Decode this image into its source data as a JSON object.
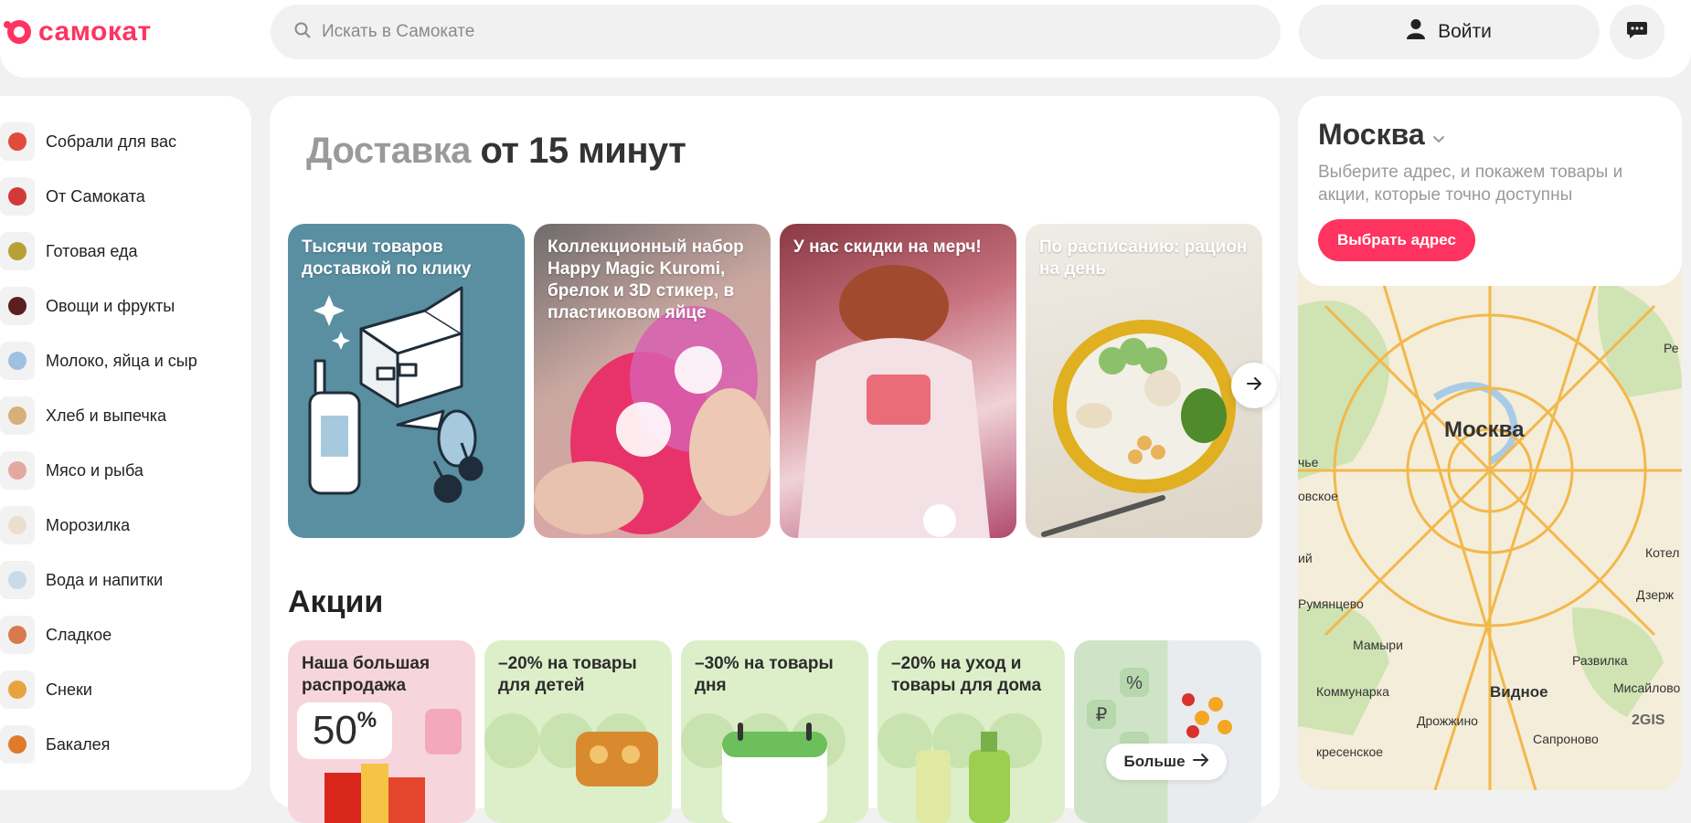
{
  "header": {
    "logo_text": "самокат",
    "search_placeholder": "Искать в Самокате",
    "login_label": "Войти"
  },
  "sidebar": {
    "items": [
      {
        "label": "Собрали для вас",
        "color": "#e04b3a"
      },
      {
        "label": "От Самоката",
        "color": "#d23a3a"
      },
      {
        "label": "Готовая еда",
        "color": "#b7a137"
      },
      {
        "label": "Овощи и фрукты",
        "color": "#5a1f1f"
      },
      {
        "label": "Молоко, яйца и сыр",
        "color": "#9fc0e0"
      },
      {
        "label": "Хлеб и выпечка",
        "color": "#d6b079"
      },
      {
        "label": "Мясо и рыба",
        "color": "#e4a8a0"
      },
      {
        "label": "Морозилка",
        "color": "#eadfcf"
      },
      {
        "label": "Вода и напитки",
        "color": "#c8dbe6"
      },
      {
        "label": "Сладкое",
        "color": "#d97a4c"
      },
      {
        "label": "Снеки",
        "color": "#e8a341"
      },
      {
        "label": "Бакалея",
        "color": "#e07a2c"
      }
    ]
  },
  "main": {
    "headline_muted": "Доставка",
    "headline_dark": "от 15 минут",
    "stories": [
      {
        "title": "Тысячи товаров доставкой по клику"
      },
      {
        "title": "Коллекционный набор Happy Magic Kuromi, брелок и 3D стикер, в пластиковом яйце"
      },
      {
        "title": "У нас скидки на мерч!"
      },
      {
        "title": "По расписанию: рацион на день"
      }
    ],
    "promos_title": "Акции",
    "promos": [
      {
        "title": "Наша большая распродажа",
        "badge": "50",
        "badge_suffix": "%"
      },
      {
        "title": "–20% на товары для детей"
      },
      {
        "title": "–30% на товары дня"
      },
      {
        "title": "–20% на уход и товары для дома"
      },
      {
        "title": "",
        "more_label": "Больше"
      }
    ]
  },
  "location": {
    "city": "Москва",
    "hint": "Выберите адрес, и покажем товары и акции, которые точно доступны",
    "button": "Выбрать адрес"
  },
  "map": {
    "city_label": "Москва",
    "labels": [
      "овское",
      "Котел",
      "Румянцево",
      "Дзерж",
      "Мамыри",
      "Развилка",
      "Коммунарка",
      "Видное",
      "Мисайлово",
      "Дрожжино",
      "Сапроново",
      "Ре",
      "чье",
      "ий",
      "кресенское"
    ],
    "attribution": "2GIS",
    "colors": {
      "base": "#f4edd9",
      "green": "#cfe3b3",
      "road": "#f2b84b",
      "water": "#a9cbe6"
    }
  }
}
